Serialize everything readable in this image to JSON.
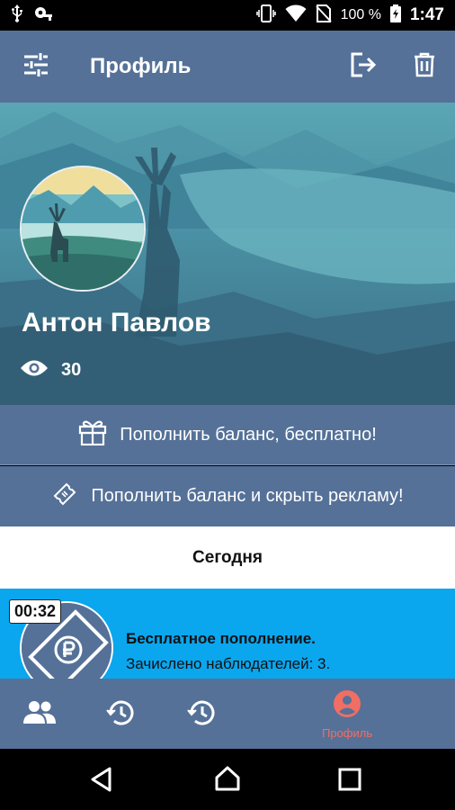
{
  "status_bar": {
    "battery": "100 %",
    "time": "1:47"
  },
  "app_bar": {
    "title": "Профиль"
  },
  "profile": {
    "name": "Антон Павлов",
    "views_count": "30"
  },
  "actions": {
    "free_topup": "Пополнить баланс, бесплатно!",
    "topup_hide_ads": "Пополнить баланс и скрыть рекламу!"
  },
  "feed": {
    "section_title": "Сегодня",
    "items": [
      {
        "time": "00:32",
        "title": "Бесплатное пополнение.",
        "text": "Зачислено наблюдателей: 3."
      }
    ]
  },
  "bottom_nav": {
    "items": [
      {
        "icon": "people-icon",
        "label": ""
      },
      {
        "icon": "history-icon",
        "label": ""
      },
      {
        "icon": "history-icon",
        "label": ""
      },
      {
        "icon": "account-circle-icon",
        "label": "Профиль"
      }
    ]
  },
  "colors": {
    "primary": "#557198",
    "accent": "#0aa6ee",
    "active_nav": "#f06e64"
  }
}
